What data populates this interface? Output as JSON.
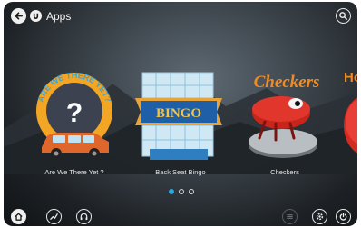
{
  "header": {
    "title": "Apps"
  },
  "apps": [
    {
      "label": "Are We There Yet ?",
      "banner": "ARE WE THERE YET?"
    },
    {
      "label": "Back Seat Bingo",
      "banner": "BINGO"
    },
    {
      "label": "Checkers",
      "banner": "Checkers"
    },
    {
      "label": "",
      "banner": "Ho"
    }
  ],
  "pager": {
    "pages": 3,
    "current": 1
  },
  "colors": {
    "accent": "#2aa8e0",
    "background": "#2b3137"
  },
  "icons": {
    "back": "back-arrow-icon",
    "app_logo": "app-logo-icon",
    "search": "search-icon",
    "home": "home-icon",
    "stats": "stats-icon",
    "audio": "headphones-icon",
    "menu": "menu-icon",
    "settings": "gear-icon",
    "power": "power-icon"
  }
}
